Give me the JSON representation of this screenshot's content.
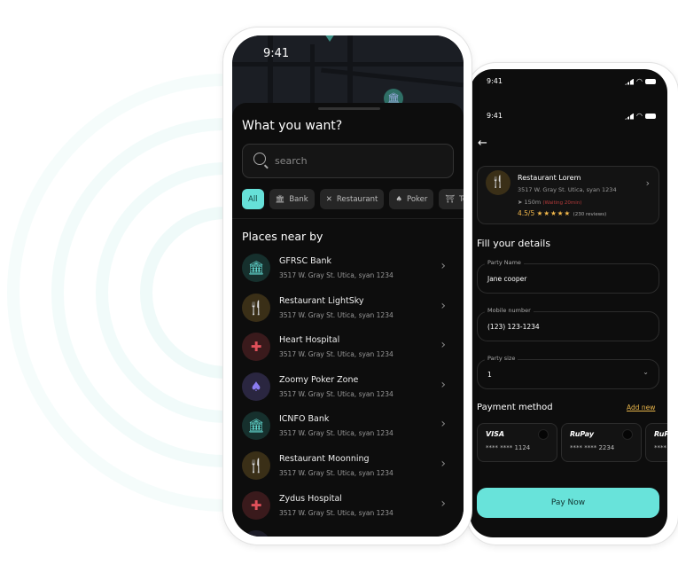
{
  "finder": {
    "time": "9:41",
    "title": "What you want?",
    "search_placeholder": "search",
    "chips": [
      {
        "label": "All",
        "icon": "none"
      },
      {
        "label": "Bank",
        "icon": "bank-icon"
      },
      {
        "label": "Restaurant",
        "icon": "utensils-icon"
      },
      {
        "label": "Poker",
        "icon": "spade-icon"
      },
      {
        "label": "Te",
        "icon": "temple-icon"
      }
    ],
    "section_title": "Places near by",
    "places": [
      {
        "name": "GFRSC Bank",
        "address": "3517 W. Gray St. Utica, syan 1234",
        "type": "bank"
      },
      {
        "name": "Restaurant LightSky",
        "address": "3517 W. Gray St. Utica, syan 1234",
        "type": "restaurant"
      },
      {
        "name": "Heart Hospital",
        "address": "3517 W. Gray St. Utica, syan 1234",
        "type": "hospital"
      },
      {
        "name": "Zoomy Poker Zone",
        "address": "3517 W. Gray St. Utica, syan 1234",
        "type": "poker"
      },
      {
        "name": "ICNFO Bank",
        "address": "3517 W. Gray St. Utica, syan 1234",
        "type": "bank"
      },
      {
        "name": "Restaurant Moonning",
        "address": "3517 W. Gray St. Utica, syan 1234",
        "type": "restaurant"
      },
      {
        "name": "Zydus Hospital",
        "address": "3517 W. Gray St. Utica, syan 1234",
        "type": "hospital"
      }
    ]
  },
  "booking": {
    "time_top": "9:41",
    "time": "9:41",
    "restaurant": {
      "name": "Restaurant Lorem",
      "address": "3517 W. Gray St. Utica, syan 1234",
      "distance": "150m",
      "waiting": "(Waiting 20min)",
      "rating": "4.5/5",
      "stars": 5,
      "reviews": "(230 reviews)"
    },
    "form_title": "Fill your details",
    "fields": {
      "party_name_label": "Party Name",
      "party_name_value": "Jane cooper",
      "mobile_label": "Mobile number",
      "mobile_value": "(123) 123-1234",
      "party_size_label": "Party size",
      "party_size_value": "1"
    },
    "payment_title": "Payment method",
    "add_new": "Add new",
    "cards": [
      {
        "brand": "VISA",
        "number": "**** **** 1124"
      },
      {
        "brand": "RuPay",
        "number": "**** **** 2234"
      },
      {
        "brand": "RuPay",
        "number": "**** ****"
      }
    ],
    "pay_button": "Pay Now"
  },
  "colors": {
    "accent": "#68e3da",
    "gold": "#f2b84b",
    "red": "#e0505a",
    "purple": "#8b7cf0"
  }
}
